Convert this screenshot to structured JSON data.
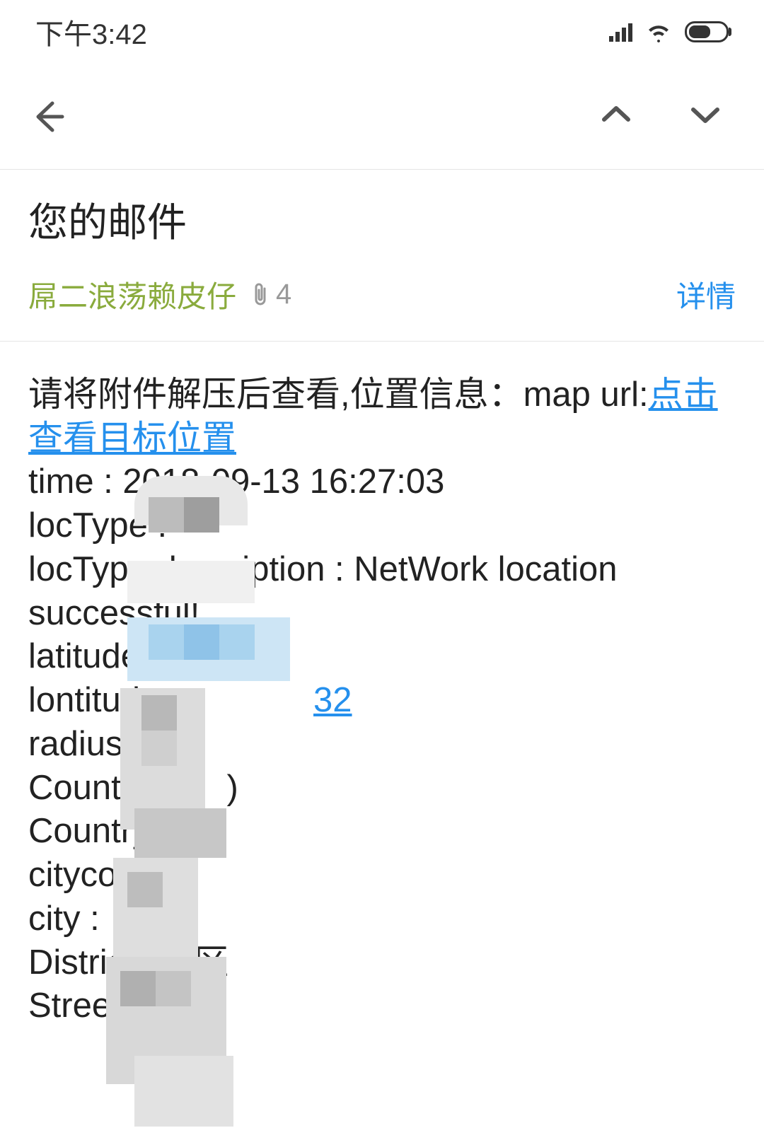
{
  "status": {
    "time": "下午3:42"
  },
  "header": {
    "title": "您的邮件",
    "sender": "屌二浪荡赖皮仔",
    "attachment_count": "4",
    "details_label": "详情"
  },
  "body": {
    "intro_prefix": "请将附件解压后查看,位置信息：map url:",
    "map_link": "点击查看目标位置",
    "time_line": "time : 2018-09-13 16:27:03",
    "loctype_line": "locType :",
    "loctype_desc": "locType description : NetWork location successful!",
    "latitude_label": "latitude",
    "longitude_label": "lontitud",
    "longitude_suffix": "32",
    "radius_label": "radius",
    "countrycode_label": "CountryC",
    "country_label": "Country :",
    "citycode_label": "citycode",
    "city_label": "city :",
    "district_label": "Distric",
    "district_suffix": "区",
    "street_label": "Street : 丰"
  }
}
